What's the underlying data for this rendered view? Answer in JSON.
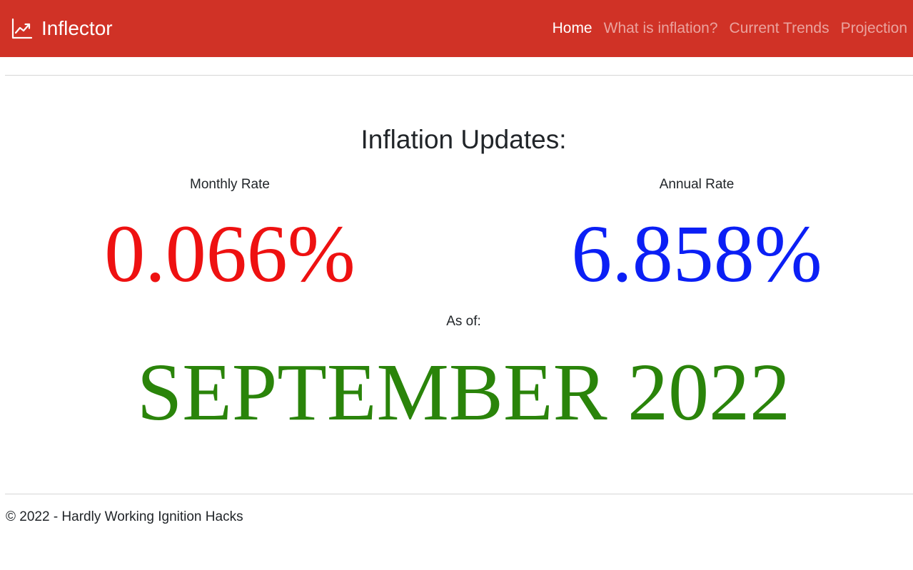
{
  "navbar": {
    "brand_icon": "line-chart-icon",
    "brand_text": "Inflector",
    "background_color": "#d03226",
    "links": [
      {
        "label": "Home",
        "active": true
      },
      {
        "label": "What is inflation?",
        "active": false
      },
      {
        "label": "Current Trends",
        "active": false
      },
      {
        "label": "Projection",
        "active": false
      }
    ]
  },
  "main": {
    "headline": "Inflation Updates:",
    "monthly": {
      "label": "Monthly Rate",
      "value": "0.066%",
      "color": "#ee1111"
    },
    "annual": {
      "label": "Annual Rate",
      "value": "6.858%",
      "color": "#0b1ff5"
    },
    "as_of": {
      "label": "As of:",
      "value": "SEPTEMBER 2022",
      "color": "#2a840a"
    }
  },
  "footer": {
    "text": "© 2022 - Hardly Working Ignition Hacks"
  }
}
